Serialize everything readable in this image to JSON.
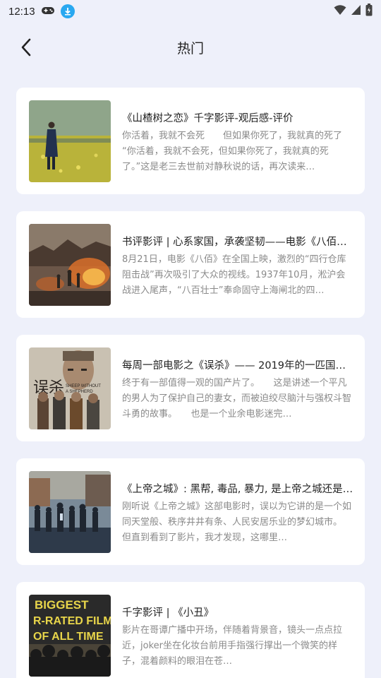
{
  "status_bar": {
    "time": "12:13",
    "icons_left": [
      "gamepad-icon",
      "download-icon"
    ],
    "icons_right": [
      "wifi-icon",
      "signal-icon",
      "battery-icon"
    ],
    "download_badge_color": "#29a8f0"
  },
  "header": {
    "back_icon": "chevron-left-icon",
    "title": "热门"
  },
  "articles": [
    {
      "title": "《山楂树之恋》千字影评-观后感-评价",
      "desc": "你活着，我就不会死　　但如果你死了，我就真的死了　　“你活着，我就不会死，但如果你死了，我就真的死了。”这是老三去世前对静秋说的话，再次读来…",
      "thumb": "man-in-rapeseed-field"
    },
    {
      "title": "书评影评 | 心系家国，承袭坚韧——电影《八佰》…",
      "desc": "8月21日，电影《八佰》在全国上映，激烈的“四行仓库阻击战”再次吸引了大众的视线。1937年10月，淞沪会战进入尾声，“八百壮士”奉命固守上海闸北的四…",
      "thumb": "soldiers-in-burning-ruins"
    },
    {
      "title": "每周一部电影之《误杀》—— 2019年的一匹国产…",
      "desc": "终于有一部值得一观的国产片了。　　这是讲述一个平凡的男人为了保护自己的妻女，而被迫绞尽脑汁与强权斗智斗勇的故事。　　也是一个业余电影迷完…",
      "thumb": "sheep-without-a-shepherd-poster",
      "poster_text_cn": "误杀",
      "poster_text_en": "SHEEP WITHOUT A SHEPHERD"
    },
    {
      "title": "《上帝之城》: 黑帮, 毒品, 暴力, 是上帝之城还是…",
      "desc": "刚听说《上帝之城》这部电影时，误以为它讲的是一个如同天堂般、秩序井井有条、人民安居乐业的梦幻城市。　　但直到看到了影片，我才发现，这哪里…",
      "thumb": "crowd-in-favela-street"
    },
    {
      "title": "千字影评 | 《小丑》",
      "desc": "影片在哥谭广播中开场，伴随着背景音，镜头一点点拉近，joker坐在化妆台前用手指强行撑出一个微笑的样子，混着颜料的眼泪在苍…",
      "thumb": "biggest-r-rated-film-poster",
      "poster_text": "BIGGEST R-RATED FILM OF ALL TIME"
    }
  ]
}
